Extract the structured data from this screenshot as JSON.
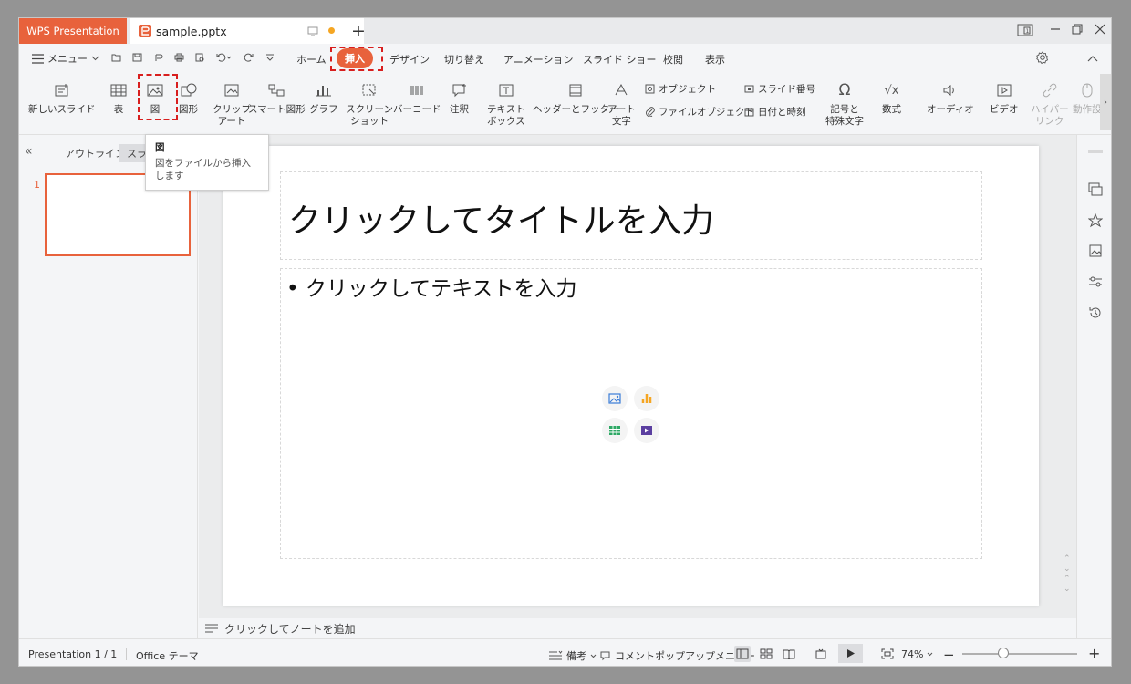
{
  "tabs": {
    "app": "WPS Presentation",
    "document": "sample.pptx"
  },
  "menu": {
    "menu_label": "メニュー",
    "tabs": [
      "ホーム",
      "挿入",
      "デザイン",
      "切り替え",
      "アニメーション",
      "スライド ショー",
      "校閲",
      "表示"
    ],
    "active_tab": "挿入"
  },
  "ribbon": {
    "new_slide": "新しいスライド",
    "table": "表",
    "picture": "図",
    "shape": "図形",
    "clipart_1": "クリップ",
    "clipart_2": "アート",
    "smart_shape": "スマート図形",
    "chart": "グラフ",
    "screenshot_1": "スクリーン",
    "screenshot_2": "ショット",
    "barcode": "バーコード",
    "comment": "注釈",
    "textbox_1": "テキスト",
    "textbox_2": "ボックス",
    "header_footer": "ヘッダーとフッター",
    "art_text_1": "アート",
    "art_text_2": "文字",
    "object": "オブジェクト",
    "file_object": "ファイルオブジェクト",
    "slide_number": "スライド番号",
    "date_time": "日付と時刻",
    "symbol_1": "記号と",
    "symbol_2": "特殊文字",
    "equation": "数式",
    "audio": "オーディオ",
    "video": "ビデオ",
    "hyperlink_1": "ハイパー",
    "hyperlink_2": "リンク",
    "action": "動作設"
  },
  "left_panel": {
    "outline_tab": "アウトライン",
    "slides_tab": "スライド",
    "slide_number": "1"
  },
  "tooltip": {
    "title": "図",
    "body": "図をファイルから挿入します"
  },
  "slide": {
    "title_placeholder": "クリックしてタイトルを入力",
    "body_placeholder": "• クリックしてテキストを入力"
  },
  "notes": {
    "placeholder": "クリックしてノートを追加"
  },
  "status": {
    "presentation": "Presentation 1 / 1",
    "theme": "Office テーマ",
    "notes_btn": "備考",
    "comment_popup": "コメントポップアップメニュー",
    "zoom": "74%"
  },
  "colors": {
    "accent": "#e8623c",
    "highlight": "#d81e1e"
  }
}
